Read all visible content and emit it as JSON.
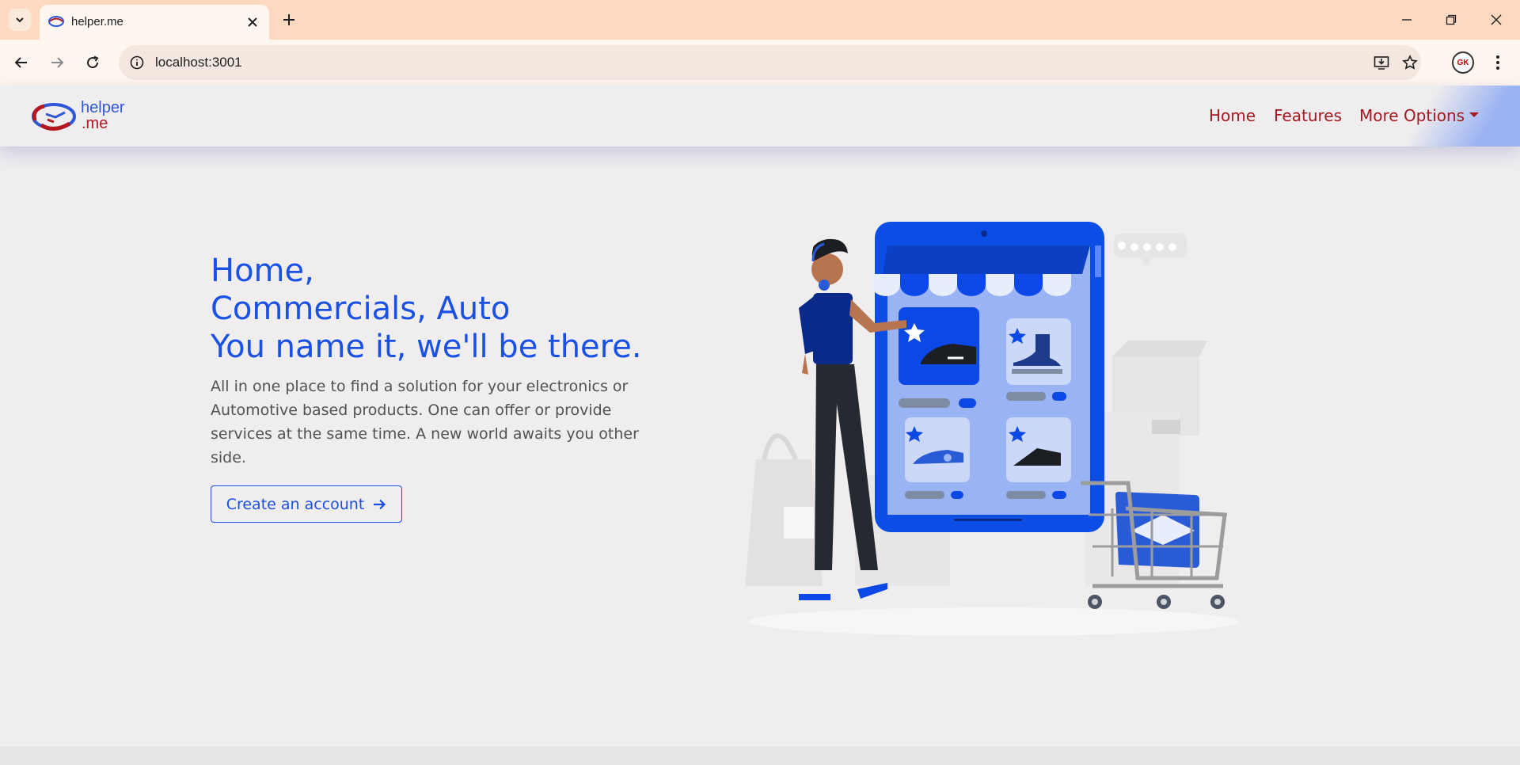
{
  "browser": {
    "tab_title": "helper.me",
    "url": "localhost:3001",
    "avatar_initials": "GK",
    "accent_color": "#fdd9c2"
  },
  "site": {
    "logo": {
      "line1": "helper",
      "line2": ".me"
    },
    "nav": {
      "home": "Home",
      "features": "Features",
      "more_options": "More Options"
    },
    "hero": {
      "title_line1": "Home,",
      "title_line2": "Commercials, Auto",
      "title_line3": "You name it, we'll be there.",
      "description": "All in one place to find a solution for your electronics or Automotive based products. One can offer or provide services at the same time. A new world awaits you other side.",
      "cta_label": "Create an account"
    },
    "colors": {
      "primary": "#1a51e4",
      "nav_link": "#a3191f",
      "background": "#efedee"
    }
  }
}
